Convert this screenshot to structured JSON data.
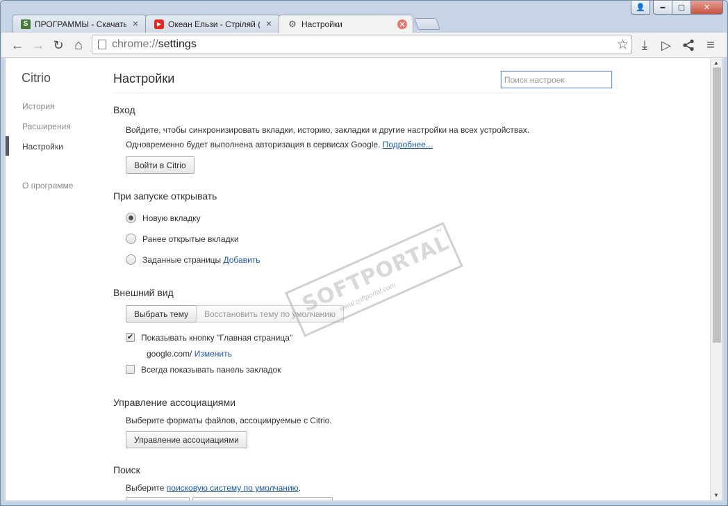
{
  "window": {
    "user_glyph": "👤",
    "minimize_glyph": "▬",
    "maximize_glyph": "▢",
    "close_glyph": "✕"
  },
  "tabs": [
    {
      "favicon": "S",
      "favicon_color": "#4a7a3a",
      "title": "ПРОГРАММЫ - Скачать б",
      "close": "✕"
    },
    {
      "favicon": "▶",
      "favicon_color": "#e02a20",
      "title": "Океан Ельзи - Стріляй (о",
      "close": "✕"
    },
    {
      "favicon": "⚙",
      "favicon_color": "#555555",
      "title": "Настройки",
      "close": "✕"
    }
  ],
  "toolbar": {
    "back": "←",
    "forward": "→",
    "reload": "↻",
    "home": "⌂",
    "url_scheme": "chrome://",
    "url_path": "settings",
    "star": "☆",
    "download": "⤓",
    "play": "▷",
    "share": "⋖",
    "menu": "≡"
  },
  "sidebar": {
    "brand": "Citrio",
    "items": [
      "История",
      "Расширения",
      "Настройки"
    ],
    "about": "О программе",
    "selected": "Настройки"
  },
  "header": {
    "title": "Настройки",
    "search_placeholder": "Поиск настроек"
  },
  "signin": {
    "heading": "Вход",
    "line1": "Войдите, чтобы синхронизировать вкладки, историю, закладки и другие настройки на всех устройствах.",
    "line2": "Одновременно будет выполнена авторизация в сервисах Google.",
    "more_link": "Подробнее...",
    "button": "Войти в Citrio"
  },
  "startup": {
    "heading": "При запуске открывать",
    "options": [
      "Новую вкладку",
      "Ранее открытые вкладки",
      "Заданные страницы"
    ],
    "selected": "Новую вкладку",
    "add_link": "Добавить"
  },
  "appearance": {
    "heading": "Внешний вид",
    "theme_button": "Выбрать тему",
    "reset_button": "Восстановить тему по умолчанию",
    "show_home": "Показывать кнопку \"Главная страница\"",
    "show_home_checked": true,
    "home_url": "google.com/",
    "change_link": "Изменить",
    "show_bookmarks": "Всегда показывать панель закладок",
    "show_bookmarks_checked": false,
    "check_glyph": "✔"
  },
  "associations": {
    "heading": "Управление ассоциациями",
    "text": "Выберите форматы файлов, ассоциируемые с Citrio.",
    "button": "Управление ассоциациями"
  },
  "search": {
    "heading": "Поиск",
    "text_prefix": "Выберите",
    "link": "поисковую систему по умолчанию",
    "text_suffix": "."
  },
  "watermark": {
    "main": "SOFTPORTAL",
    "tm": "™",
    "sub": "www.softportal.com"
  },
  "colors": {
    "link": "#1b58b3",
    "frame": "#c6d4e5",
    "search_focus": "#6a9ad4"
  }
}
